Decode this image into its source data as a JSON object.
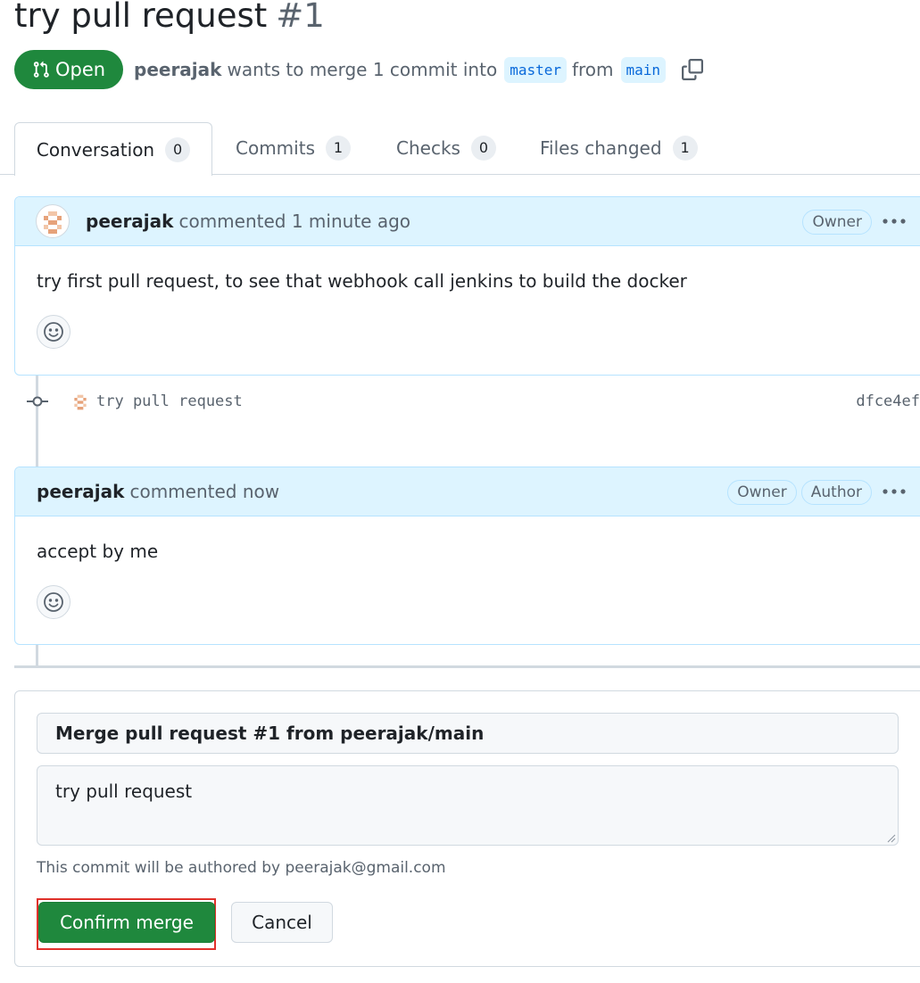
{
  "pr": {
    "title": "try pull request",
    "number": "#1",
    "state": "Open"
  },
  "meta": {
    "author": "peerajak",
    "text": "wants to merge 1 commit into",
    "base_branch": "master",
    "from_text": "from",
    "head_branch": "main"
  },
  "tabs": [
    {
      "label": "Conversation",
      "count": "0"
    },
    {
      "label": "Commits",
      "count": "1"
    },
    {
      "label": "Checks",
      "count": "0"
    },
    {
      "label": "Files changed",
      "count": "1"
    }
  ],
  "comments": [
    {
      "author": "peerajak",
      "action": "commented 1 minute ago",
      "labels": [
        "Owner"
      ],
      "body": "try first pull request, to see that webhook call jenkins to build the docker"
    },
    {
      "author": "peerajak",
      "action": "commented now",
      "labels": [
        "Owner",
        "Author"
      ],
      "body": "accept by me"
    }
  ],
  "commit": {
    "message": "try pull request",
    "sha": "dfce4ef"
  },
  "merge": {
    "title": "Merge pull request #1 from peerajak/main",
    "message": "try pull request",
    "note": "This commit will be authored by peerajak@gmail.com",
    "confirm_label": "Confirm merge",
    "cancel_label": "Cancel"
  },
  "colors": {
    "success": "#1f883d",
    "accent": "#0969da",
    "highlight": "#e0312b"
  }
}
